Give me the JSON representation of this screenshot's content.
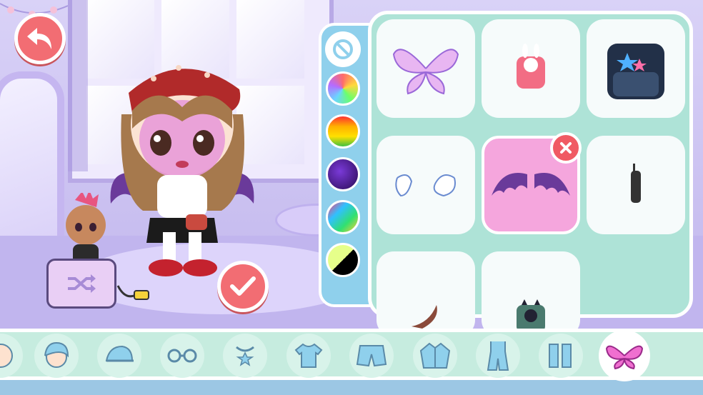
{
  "colors": {
    "accent": "#f26d73",
    "panel_bg": "#aee3d7",
    "palette_bg": "#8fd0ec",
    "tabbar_bg": "#c6ecdf",
    "selected_item": "#f5a6dd"
  },
  "top": {
    "back_icon": "back-arrow-icon",
    "confirm_icon": "checkmark-icon"
  },
  "random_box": {
    "icon": "shuffle-icon"
  },
  "palette": {
    "reset_icon": "reset-icon",
    "swatches": [
      "rainbow-light",
      "rainbow-warm",
      "galaxy-purple",
      "rainbow-cool",
      "lime-black"
    ]
  },
  "items": [
    {
      "name": "fairy-wings",
      "selected": false
    },
    {
      "name": "bunny-backpack",
      "selected": false
    },
    {
      "name": "star-backpack",
      "selected": false
    },
    {
      "name": "angel-wings",
      "selected": false
    },
    {
      "name": "bat-wings",
      "selected": true
    },
    {
      "name": "waist-pouch",
      "selected": false
    },
    {
      "name": "tail",
      "selected": false
    },
    {
      "name": "cat-backpack",
      "selected": false
    }
  ],
  "tabs": [
    {
      "name": "skin",
      "active": false
    },
    {
      "name": "hair",
      "active": false
    },
    {
      "name": "hat",
      "active": false
    },
    {
      "name": "glasses",
      "active": false
    },
    {
      "name": "necklace",
      "active": false
    },
    {
      "name": "top",
      "active": false
    },
    {
      "name": "shorts",
      "active": false
    },
    {
      "name": "jacket",
      "active": false
    },
    {
      "name": "overalls",
      "active": false
    },
    {
      "name": "boots",
      "active": false
    },
    {
      "name": "wings",
      "active": true
    }
  ]
}
